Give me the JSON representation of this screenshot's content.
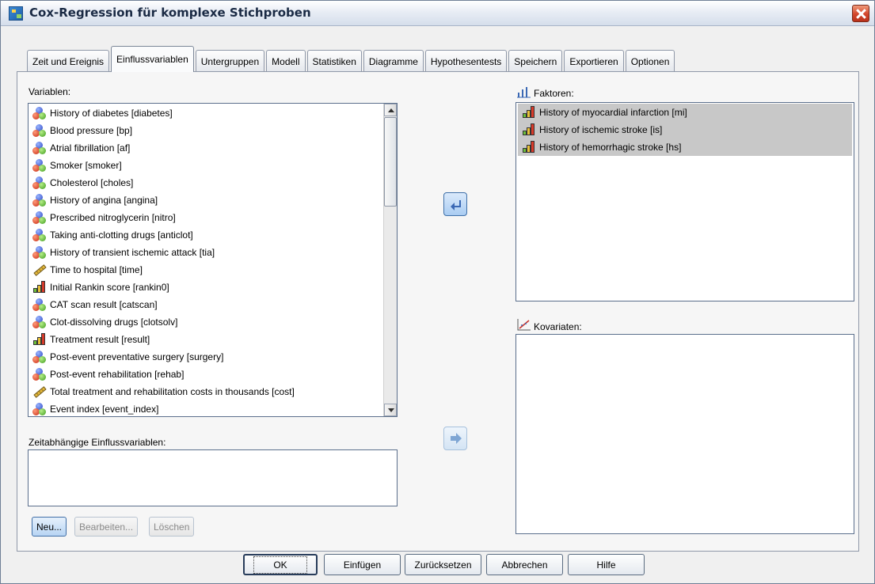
{
  "window": {
    "title": "Cox-Regression für komplexe Stichproben"
  },
  "tabs": [
    {
      "label": "Zeit und Ereignis",
      "active": false
    },
    {
      "label": "Einflussvariablen",
      "active": true
    },
    {
      "label": "Untergruppen",
      "active": false
    },
    {
      "label": "Modell",
      "active": false
    },
    {
      "label": "Statistiken",
      "active": false
    },
    {
      "label": "Diagramme",
      "active": false
    },
    {
      "label": "Hypothesentests",
      "active": false
    },
    {
      "label": "Speichern",
      "active": false
    },
    {
      "label": "Exportieren",
      "active": false
    },
    {
      "label": "Optionen",
      "active": false
    }
  ],
  "variables": {
    "label": "Variablen:",
    "items": [
      {
        "text": "History of diabetes [diabetes]",
        "icon": "nominal-icon"
      },
      {
        "text": "Blood pressure [bp]",
        "icon": "nominal-icon"
      },
      {
        "text": "Atrial fibrillation [af]",
        "icon": "nominal-icon"
      },
      {
        "text": "Smoker [smoker]",
        "icon": "nominal-icon"
      },
      {
        "text": "Cholesterol [choles]",
        "icon": "nominal-icon"
      },
      {
        "text": "History of angina [angina]",
        "icon": "nominal-icon"
      },
      {
        "text": "Prescribed nitroglycerin [nitro]",
        "icon": "nominal-icon"
      },
      {
        "text": "Taking anti-clotting drugs [anticlot]",
        "icon": "nominal-icon"
      },
      {
        "text": "History of transient ischemic attack [tia]",
        "icon": "nominal-icon"
      },
      {
        "text": "Time to hospital [time]",
        "icon": "scale-icon"
      },
      {
        "text": "Initial Rankin score [rankin0]",
        "icon": "ordinal-icon"
      },
      {
        "text": "CAT scan result [catscan]",
        "icon": "nominal-icon"
      },
      {
        "text": "Clot-dissolving drugs [clotsolv]",
        "icon": "nominal-icon"
      },
      {
        "text": "Treatment result [result]",
        "icon": "ordinal-icon"
      },
      {
        "text": "Post-event preventative surgery [surgery]",
        "icon": "nominal-icon"
      },
      {
        "text": "Post-event rehabilitation [rehab]",
        "icon": "nominal-icon"
      },
      {
        "text": "Total treatment and rehabilitation costs in thousands [cost]",
        "icon": "scale-icon"
      },
      {
        "text": "Event index [event_index]",
        "icon": "nominal-icon"
      }
    ]
  },
  "factors": {
    "label": "Faktoren:",
    "items": [
      {
        "text": "History of myocardial infarction [mi]",
        "icon": "ordinal-icon"
      },
      {
        "text": "History of ischemic stroke [is]",
        "icon": "ordinal-icon"
      },
      {
        "text": "History of hemorrhagic stroke [hs]",
        "icon": "ordinal-icon"
      }
    ]
  },
  "covariates": {
    "label": "Kovariaten:"
  },
  "time_dependent": {
    "label": "Zeitabhängige Einflussvariablen:"
  },
  "small_buttons": {
    "new": "Neu...",
    "edit": "Bearbeiten...",
    "delete": "Löschen"
  },
  "buttons": {
    "ok": "OK",
    "paste": "Einfügen",
    "reset": "Zurücksetzen",
    "cancel": "Abbrechen",
    "help": "Hilfe"
  },
  "colors": {
    "accent": "#3f6ea6",
    "selection": "#c8c8c8"
  }
}
